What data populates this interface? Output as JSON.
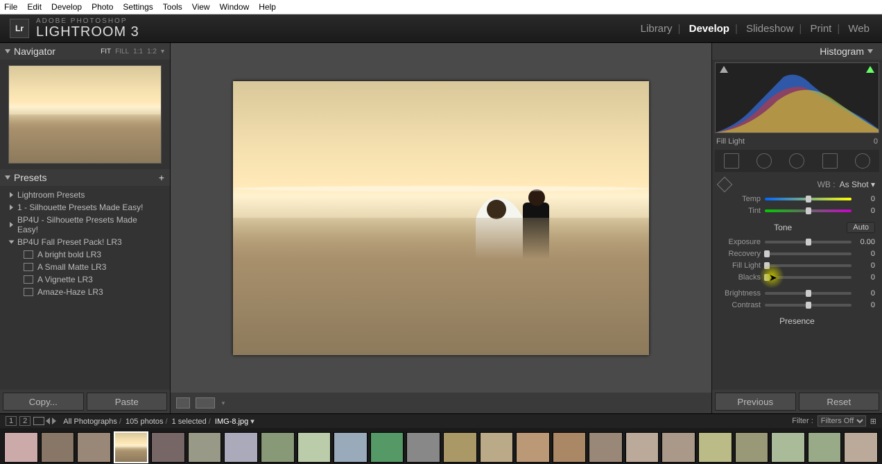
{
  "menubar": [
    "File",
    "Edit",
    "Develop",
    "Photo",
    "Settings",
    "Tools",
    "View",
    "Window",
    "Help"
  ],
  "brand": {
    "sub": "ADOBE PHOTOSHOP",
    "main": "LIGHTROOM 3"
  },
  "modules": [
    "Library",
    "Develop",
    "Slideshow",
    "Print",
    "Web"
  ],
  "active_module": "Develop",
  "navigator": {
    "title": "Navigator",
    "opts": [
      "FIT",
      "FILL",
      "1:1",
      "1:2"
    ],
    "active": "FIT"
  },
  "presets": {
    "title": "Presets",
    "folders": [
      {
        "name": "Lightroom Presets",
        "open": false
      },
      {
        "name": "1 - Silhouette Presets Made Easy!",
        "open": false
      },
      {
        "name": "BP4U - Silhouette Presets Made Easy!",
        "open": false
      },
      {
        "name": "BP4U Fall Preset Pack! LR3",
        "open": true,
        "items": [
          "A bright bold LR3",
          "A Small Matte LR3",
          "A Vignette LR3",
          "Amaze-Haze LR3"
        ]
      }
    ]
  },
  "left_buttons": {
    "copy": "Copy...",
    "paste": "Paste"
  },
  "histogram": {
    "title": "Histogram",
    "readout_label": "Fill Light",
    "readout_value": "0"
  },
  "wb": {
    "label": "WB :",
    "value": "As Shot"
  },
  "sliders": {
    "temp": {
      "label": "Temp",
      "value": "0",
      "pos": 50
    },
    "tint": {
      "label": "Tint",
      "value": "0",
      "pos": 50
    },
    "tone_title": "Tone",
    "auto": "Auto",
    "exposure": {
      "label": "Exposure",
      "value": "0.00",
      "pos": 50
    },
    "recovery": {
      "label": "Recovery",
      "value": "0",
      "pos": 2
    },
    "filllight": {
      "label": "Fill Light",
      "value": "0",
      "pos": 2
    },
    "blacks": {
      "label": "Blacks",
      "value": "0",
      "pos": 2
    },
    "brightness": {
      "label": "Brightness",
      "value": "0",
      "pos": 50
    },
    "contrast": {
      "label": "Contrast",
      "value": "0",
      "pos": 50
    },
    "presence": "Presence"
  },
  "right_buttons": {
    "prev": "Previous",
    "reset": "Reset"
  },
  "filmstrip": {
    "path": [
      "All Photographs",
      "105 photos",
      "1 selected",
      "IMG-8.jpg"
    ],
    "filter_label": "Filter :",
    "filter_value": "Filters Off",
    "pages": [
      "1",
      "2"
    ]
  }
}
